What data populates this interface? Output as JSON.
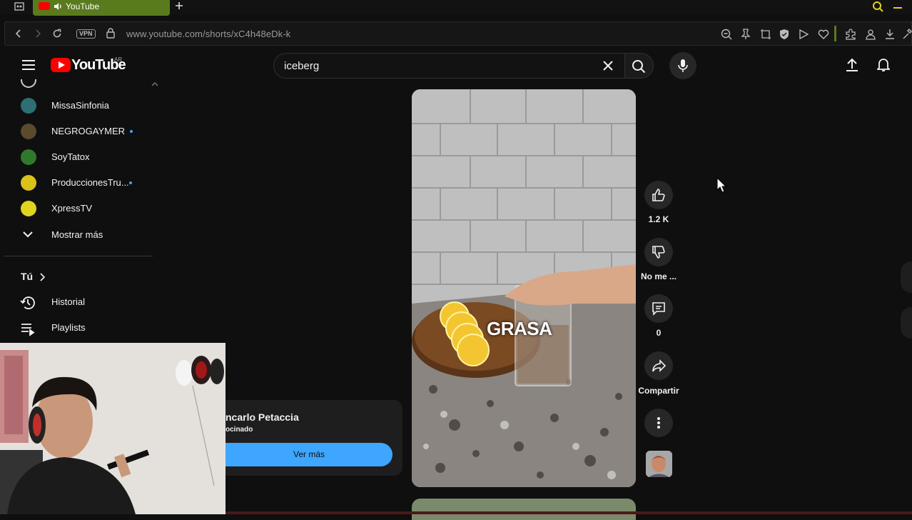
{
  "browser": {
    "tab_title": "YouTube",
    "url": "www.youtube.com/shorts/xC4h48eDk-k",
    "vpn_label": "VPN"
  },
  "masthead": {
    "logo_text": "YouTube",
    "country_code": "AR",
    "search_value": "iceberg"
  },
  "sidebar": {
    "subscriptions": [
      {
        "name": "MissaSinfonia",
        "new": false,
        "color": "#2e6f73"
      },
      {
        "name": "NEGROGAYMER",
        "new": true,
        "color": "#5a4a2e"
      },
      {
        "name": "SoyTatox",
        "new": false,
        "color": "#2f7a2a"
      },
      {
        "name": "ProduccionesTru...",
        "new": true,
        "color": "#d9c21a"
      },
      {
        "name": "XpressTV",
        "new": false,
        "color": "#e0d41e"
      }
    ],
    "show_more": "Mostrar más",
    "you_section": "Tú",
    "history": "Historial",
    "playlists": "Playlists"
  },
  "ad": {
    "title": "ncarlo Petaccia",
    "subtitle": "ocinado",
    "button": "Ver más"
  },
  "video": {
    "overlay_text": "GRASA"
  },
  "actions": {
    "likes": "1.2 K",
    "dislike": "No me ...",
    "comments": "0",
    "share": "Compartir"
  },
  "colors": {
    "accent_blue": "#3ea6ff",
    "youtube_red": "#ff0000",
    "background": "#0f0f0f"
  }
}
